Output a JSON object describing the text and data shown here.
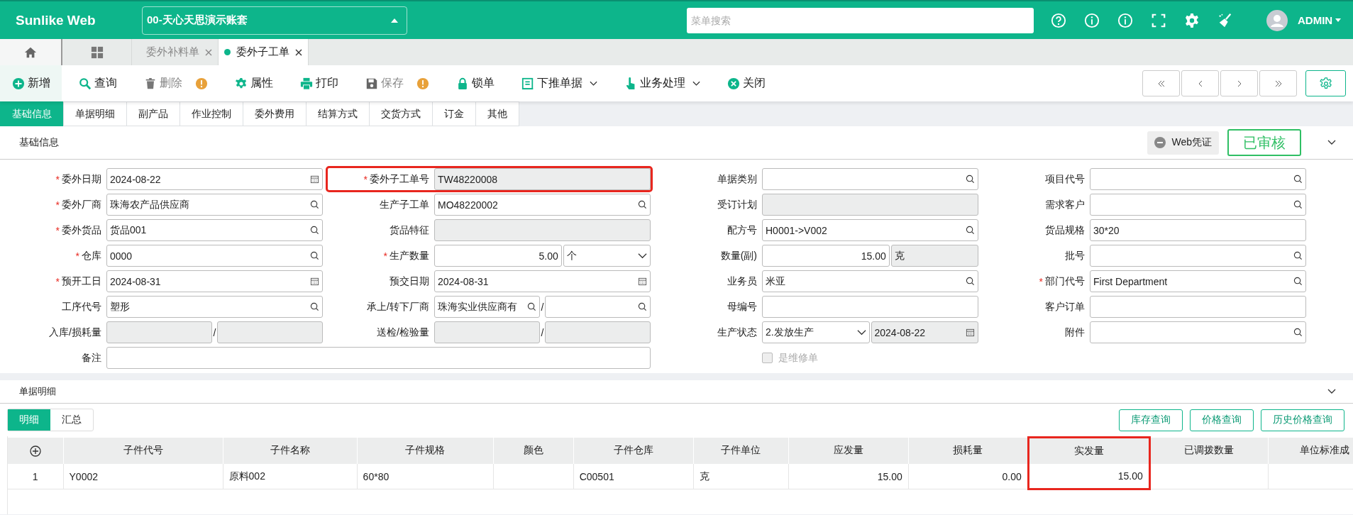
{
  "header": {
    "logo": "Sunlike Web",
    "account": "00-天心天思演示账套",
    "search": {
      "placeholder": "菜单搜索"
    },
    "user": "ADMIN"
  },
  "tabs": [
    {
      "label": "委外补料单",
      "selected": false
    },
    {
      "label": "委外子工单",
      "selected": true
    }
  ],
  "toolbar": [
    {
      "kind": "add",
      "label": "新增",
      "disabled": false,
      "warning": false,
      "dropdown": false
    },
    {
      "kind": "search",
      "label": "查询",
      "disabled": false,
      "warning": false,
      "dropdown": false
    },
    {
      "kind": "delete",
      "label": "删除",
      "disabled": true,
      "warning": true,
      "dropdown": false
    },
    {
      "kind": "properties",
      "label": "属性",
      "disabled": false,
      "warning": false,
      "dropdown": false
    },
    {
      "kind": "print",
      "label": "打印",
      "disabled": false,
      "warning": false,
      "dropdown": false
    },
    {
      "kind": "save",
      "label": "保存",
      "disabled": true,
      "warning": true,
      "dropdown": false
    },
    {
      "kind": "lock",
      "label": "锁单",
      "disabled": false,
      "warning": false,
      "dropdown": false
    },
    {
      "kind": "push",
      "label": "下推单据",
      "disabled": false,
      "warning": false,
      "dropdown": true
    },
    {
      "kind": "process",
      "label": "业务处理",
      "disabled": false,
      "warning": false,
      "dropdown": true
    },
    {
      "kind": "close",
      "label": "关闭",
      "disabled": false,
      "warning": false,
      "dropdown": false
    }
  ],
  "subtabs": [
    {
      "label": "基础信息",
      "selected": true
    },
    {
      "label": "单据明细",
      "selected": false
    },
    {
      "label": "副产品",
      "selected": false
    },
    {
      "label": "作业控制",
      "selected": false
    },
    {
      "label": "委外费用",
      "selected": false
    },
    {
      "label": "结算方式",
      "selected": false
    },
    {
      "label": "交货方式",
      "selected": false
    },
    {
      "label": "订金",
      "selected": false
    },
    {
      "label": "其他",
      "selected": false
    }
  ],
  "basic": {
    "title": "基础信息",
    "voucher": "Web凭证",
    "status": "已审核"
  },
  "form": {
    "rows": [
      [
        {
          "label": "委外日期",
          "required_mark": "*",
          "kind": "date",
          "value": "2024-08-22",
          "highlighted": false
        },
        {
          "label": "委外子工单号",
          "required_mark": "*",
          "kind": "readonly",
          "value": "TW48220008",
          "highlighted": true
        },
        {
          "label": "单据类别",
          "kind": "lookup",
          "highlighted": false
        },
        {
          "label": "项目代号",
          "kind": "lookup",
          "highlighted": false
        }
      ],
      [
        {
          "label": "委外厂商",
          "required_mark": "*",
          "kind": "lookup",
          "value": "珠海农产品供应商",
          "highlighted": false
        },
        {
          "label": "生产子工单",
          "kind": "lookup",
          "value": "MO48220002",
          "highlighted": false
        },
        {
          "label": "受订计划",
          "kind": "readonly",
          "highlighted": false
        },
        {
          "label": "需求客户",
          "kind": "lookup",
          "highlighted": false
        }
      ],
      [
        {
          "label": "委外货品",
          "required_mark": "*",
          "kind": "lookup",
          "value": "货品001",
          "highlighted": false
        },
        {
          "label": "货品特征",
          "kind": "readonly",
          "highlighted": false
        },
        {
          "label": "配方号",
          "kind": "lookup",
          "value": "H0001->V002",
          "highlighted": false
        },
        {
          "label": "货品规格",
          "kind": "text",
          "value": "30*20",
          "highlighted": false
        }
      ],
      [
        {
          "label": "仓库",
          "required_mark": "*",
          "kind": "lookup",
          "value": "0000",
          "highlighted": false
        },
        {
          "label": "生产数量",
          "required_mark": "*",
          "kind": "qty-select",
          "value": "5.00",
          "unit": "个",
          "highlighted": false
        },
        {
          "label": "数量(副)",
          "kind": "qty-unit",
          "value": "15.00",
          "unit": "克",
          "highlighted": false
        },
        {
          "label": "批号",
          "kind": "lookup",
          "highlighted": false
        }
      ],
      [
        {
          "label": "预开工日",
          "required_mark": "*",
          "kind": "date",
          "value": "2024-08-31",
          "highlighted": false
        },
        {
          "label": "预交日期",
          "kind": "date",
          "value": "2024-08-31",
          "highlighted": false
        },
        {
          "label": "业务员",
          "kind": "lookup",
          "value": "米亚",
          "highlighted": false
        },
        {
          "label": "部门代号",
          "required_mark": "*",
          "kind": "lookup",
          "value": "First Department",
          "highlighted": false
        }
      ],
      [
        {
          "label": "工序代号",
          "kind": "lookup",
          "value": "塑形",
          "highlighted": false
        },
        {
          "label": "承上/转下厂商",
          "kind": "pair-lookup",
          "values": [
            "珠海实业供应商有"
          ],
          "separator": "/",
          "highlighted": false
        },
        {
          "label": "母编号",
          "kind": "text",
          "highlighted": false
        },
        {
          "label": "客户订单",
          "kind": "text",
          "highlighted": false
        }
      ],
      [
        {
          "label": "入库/损耗量",
          "kind": "pair-readonly",
          "separator": "/",
          "highlighted": false
        },
        {
          "label": "送检/检验量",
          "kind": "pair-readonly",
          "separator": "/",
          "highlighted": false
        },
        {
          "label": "生产状态",
          "kind": "select-date",
          "value": "2.发放生产",
          "date": "2024-08-22",
          "highlighted": false
        },
        {
          "label": "附件",
          "kind": "lookup",
          "highlighted": false
        }
      ],
      [
        {
          "label": "备注",
          "kind": "remark",
          "highlighted": false
        },
        {
          "kind": "checkbox",
          "label": "是维修单",
          "checked": false,
          "disabled": true
        }
      ]
    ]
  },
  "detail": {
    "title": "单据明细",
    "tabs": [
      {
        "label": "明细",
        "selected": true
      },
      {
        "label": "汇总",
        "selected": false
      }
    ],
    "buttons": [
      "库存查询",
      "价格查询",
      "历史价格查询"
    ],
    "columns": [
      {
        "kind": "add-row",
        "highlighted": false
      },
      {
        "kind": "text",
        "label": "子件代号",
        "highlighted": false
      },
      {
        "kind": "text",
        "label": "子件名称",
        "highlighted": false
      },
      {
        "kind": "text",
        "label": "子件规格",
        "highlighted": false
      },
      {
        "kind": "text",
        "label": "颜色",
        "highlighted": false
      },
      {
        "kind": "text",
        "label": "子件仓库",
        "highlighted": false
      },
      {
        "kind": "text",
        "label": "子件单位",
        "highlighted": false
      },
      {
        "kind": "number",
        "label": "应发量",
        "highlighted": false
      },
      {
        "kind": "number",
        "label": "损耗量",
        "highlighted": false
      },
      {
        "kind": "number",
        "label": "实发量",
        "highlighted": true
      },
      {
        "kind": "number",
        "label": "已调拨数量",
        "highlighted": false
      },
      {
        "kind": "number",
        "label": "单位标准成",
        "highlighted": false
      }
    ],
    "rows": [
      {
        "cells": [
          "1",
          "Y0002",
          "原料002",
          "60*80",
          null,
          "C00501",
          "克",
          "15.00",
          "0.00",
          "15.00",
          null,
          null
        ]
      }
    ]
  }
}
